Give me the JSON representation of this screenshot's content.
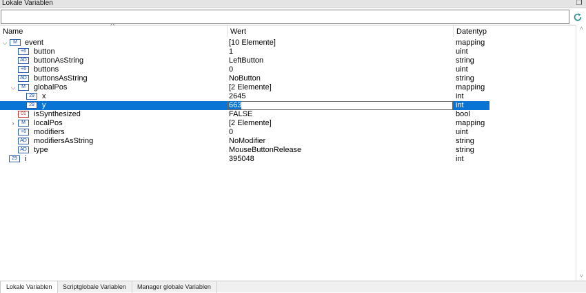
{
  "panel": {
    "title": "Lokale Variablen",
    "float_icon": "restore-icon"
  },
  "filter": {
    "value": "",
    "placeholder": ""
  },
  "columns": {
    "name": "Name",
    "value": "Wert",
    "type": "Datentyp"
  },
  "rows": [
    {
      "name": "event",
      "value": "[10 Elemente]",
      "type": "mapping",
      "badge": "M",
      "expander": "down"
    },
    {
      "name": "button",
      "value": "1",
      "type": "uint",
      "badge": "+6"
    },
    {
      "name": "buttonAsString",
      "value": "LeftButton",
      "type": "string",
      "badge": "AD"
    },
    {
      "name": "buttons",
      "value": "0",
      "type": "uint",
      "badge": "+6"
    },
    {
      "name": "buttonsAsString",
      "value": "NoButton",
      "type": "string",
      "badge": "AD"
    },
    {
      "name": "globalPos",
      "value": "[2 Elemente]",
      "type": "mapping",
      "badge": "M",
      "expander": "down"
    },
    {
      "name": "x",
      "value": "2645",
      "type": "int",
      "badge": "29"
    },
    {
      "name": "y",
      "value": "663",
      "type": "int",
      "badge": "29",
      "selected": true
    },
    {
      "name": "isSynthesized",
      "value": "FALSE",
      "type": "bool",
      "badge": "01"
    },
    {
      "name": "localPos",
      "value": "[2 Elemente]",
      "type": "mapping",
      "badge": "M",
      "expander": "right"
    },
    {
      "name": "modifiers",
      "value": "0",
      "type": "uint",
      "badge": "+6"
    },
    {
      "name": "modifiersAsString",
      "value": "NoModifier",
      "type": "string",
      "badge": "AD"
    },
    {
      "name": "type",
      "value": "MouseButtonRelease",
      "type": "string",
      "badge": "AD"
    },
    {
      "name": "i",
      "value": "395048",
      "type": "int",
      "badge": "29"
    }
  ],
  "tabs": [
    "Lokale Variablen",
    "Scriptglobale Variablen",
    "Manager globale Variablen"
  ],
  "colors": {
    "selection": "#0a74d4",
    "badge": "#2a5db0",
    "bool_badge": "#c03030",
    "refresh": "#2a8a8a"
  }
}
